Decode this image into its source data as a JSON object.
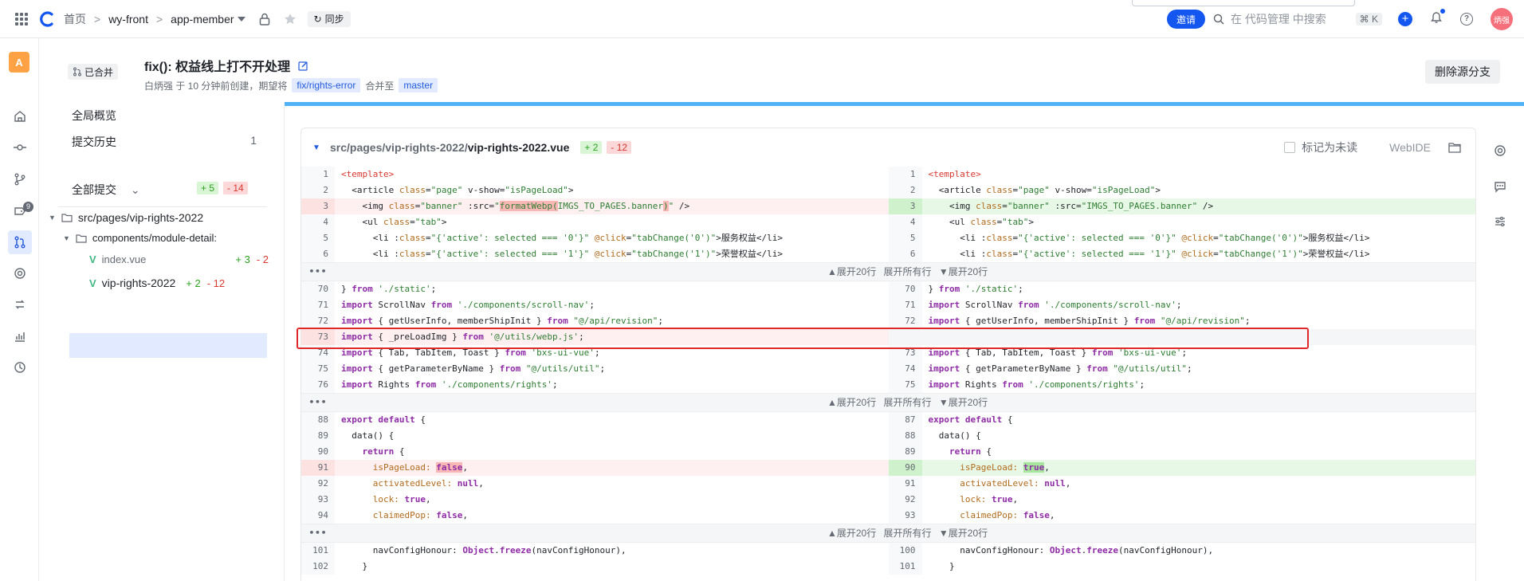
{
  "topbar": {
    "home": "首页",
    "group": "wy-front",
    "repo": "app-member",
    "sync_label": "同步",
    "invite_label": "邀请",
    "search_placeholder": "在 代码管理 中搜索",
    "search_shortcut": "⌘ K",
    "avatar_text": "炳强",
    "brand_color": "#1456f0"
  },
  "rail": {
    "avatar_letter": "A",
    "badge_count": "9",
    "icons": [
      "home-icon",
      "commit-icon",
      "branch-icon",
      "tag-icon",
      "merge-request-icon",
      "review-icon",
      "sync-icon",
      "chart-icon",
      "history-icon"
    ]
  },
  "mr": {
    "status": "已合并",
    "title": "fix(): 权益线上打不开处理",
    "author_line": "白炳强 于 10 分钟前创建，期望将",
    "source_branch": "fix/rights-error",
    "merge_to": "合并至",
    "target_branch": "master",
    "delete_branch_label": "删除源分支"
  },
  "side": {
    "overview": "全局概览",
    "history": "提交历史",
    "history_count": "1",
    "all_commits": "全部提交",
    "all_add": "+ 5",
    "all_del": "- 14",
    "tree": {
      "folder": "src/pages/vip-rights-2022",
      "subfolder": "components/module-detail:",
      "file1": "index.vue",
      "file1_add": "+ 3",
      "file1_del": "- 2",
      "file2": "vip-rights-2022",
      "file2_add": "+ 2",
      "file2_del": "- 12"
    }
  },
  "diff": {
    "path_prefix": "src/pages/vip-rights-2022/",
    "path_file": "vip-rights-2022.vue",
    "add": "+ 2",
    "del": "- 12",
    "mark_unread": "标记为未读",
    "webide": "WebIDE",
    "fold_label": "▲展开20行 展开所有行 ▼展开20行"
  }
}
